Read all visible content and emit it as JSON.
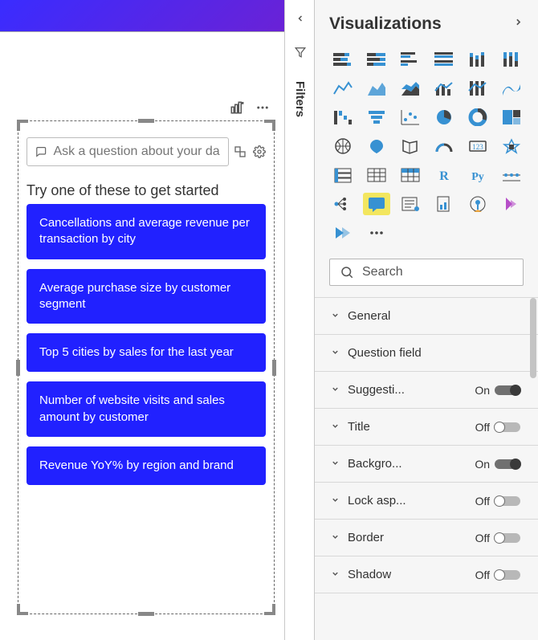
{
  "canvas": {
    "qa_placeholder": "Ask a question about your data",
    "try_text": "Try one of these to get started",
    "suggestions": [
      "Cancellations and average revenue per transaction by city",
      "Average purchase size by customer segment",
      "Top 5 cities by sales for the last year",
      "Number of website visits and sales amount by customer",
      "Revenue YoY% by region and brand"
    ]
  },
  "filters_label": "Filters",
  "viz": {
    "title": "Visualizations",
    "search_placeholder": "Search",
    "icons": [
      "stacked-bar",
      "stacked-bar-100",
      "clustered-bar",
      "clustered-bar-100",
      "stacked-column",
      "stacked-column-100",
      "line",
      "area",
      "stacked-area",
      "combo-line-column",
      "combo-line-column-100",
      "ribbon",
      "waterfall",
      "funnel",
      "scatter",
      "pie",
      "donut",
      "treemap",
      "map",
      "filled-map",
      "shape-map",
      "gauge",
      "card",
      "kpi",
      "multirow-card",
      "table",
      "matrix",
      "r-visual",
      "py-visual",
      "key-influencers",
      "decomposition-tree",
      "qna",
      "narrative",
      "paginated",
      "arcgis",
      "powerapps",
      "power-automate",
      "more"
    ],
    "icon_labels": {
      "r-visual": "R",
      "py-visual": "Py"
    },
    "selected_icon": "qna",
    "format": [
      {
        "label": "General",
        "state": ""
      },
      {
        "label": "Question field",
        "state": ""
      },
      {
        "label": "Suggesti...",
        "state": "On"
      },
      {
        "label": "Title",
        "state": "Off"
      },
      {
        "label": "Backgro...",
        "state": "On"
      },
      {
        "label": "Lock asp...",
        "state": "Off"
      },
      {
        "label": "Border",
        "state": "Off"
      },
      {
        "label": "Shadow",
        "state": "Off"
      }
    ]
  },
  "colors": {
    "accent": "#2121ff",
    "icon_dark": "#444444",
    "icon_blue": "#3791d2"
  }
}
